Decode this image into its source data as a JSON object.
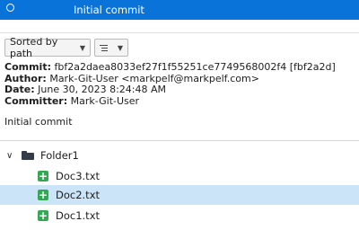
{
  "history": {
    "selected_commit_message": "Initial commit"
  },
  "toolbar": {
    "sort_label": "Sorted by path",
    "sort_icon": "chevron-down-icon",
    "view_icon": "list-icon"
  },
  "commit_details": {
    "commit_label": "Commit:",
    "commit_value": "fbf2a2daea8033ef27f1f55251ce7749568002f4 [fbf2a2d]",
    "author_label": "Author:",
    "author_value": "Mark-Git-User <markpelf@markpelf.com>",
    "date_label": "Date:",
    "date_value": "June 30, 2023 8:24:48 AM",
    "committer_label": "Committer:",
    "committer_value": "Mark-Git-User",
    "message": "Initial commit"
  },
  "file_tree": {
    "folder": {
      "name": "Folder1",
      "icon": "folder-icon",
      "expanded": true
    },
    "files": [
      {
        "name": "Doc3.txt",
        "status": "added",
        "selected": false
      },
      {
        "name": "Doc2.txt",
        "status": "added",
        "selected": true
      },
      {
        "name": "Doc1.txt",
        "status": "added",
        "selected": false
      }
    ]
  },
  "colors": {
    "selection_blue": "#0a73d9",
    "selected_row": "#cce4f7",
    "added_green": "#32a852"
  }
}
